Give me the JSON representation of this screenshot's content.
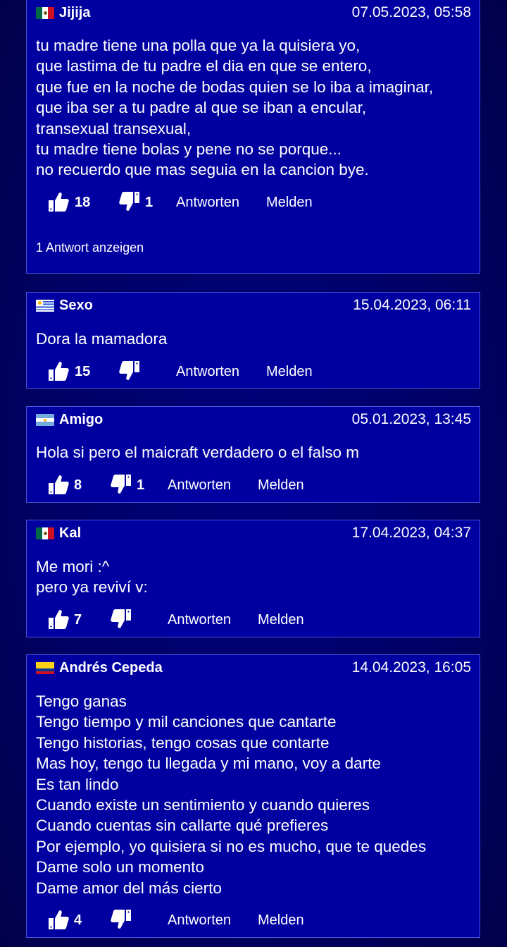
{
  "labels": {
    "reply": "Antworten",
    "report": "Melden"
  },
  "comments": [
    {
      "user": "Jijija",
      "flag": "mexico",
      "date": "07.05.2023, 05:58",
      "lines": [
        "tu madre tiene una polla que ya la quisiera yo,",
        "que lastima de tu padre el dia en que se entero,",
        "que fue en la noche de bodas quien se lo iba a imaginar,",
        "que iba ser a tu padre al que se iban a encular,",
        "transexual transexual,",
        "tu madre tiene bolas y pene no se porque...",
        "no recuerdo que mas seguia en la cancion bye."
      ],
      "likes": "18",
      "dislikes": "1",
      "show_replies": "1 Antwort anzeigen"
    },
    {
      "user": "Sexo",
      "flag": "uruguay",
      "date": "15.04.2023, 06:11",
      "lines": [
        "Dora la mamadora"
      ],
      "likes": "15",
      "dislikes": ""
    },
    {
      "user": "Amigo",
      "flag": "argentina",
      "date": "05.01.2023, 13:45",
      "lines": [
        "Hola si pero el maicraft verdadero o el falso m"
      ],
      "likes": "8",
      "dislikes": "1"
    },
    {
      "user": "Kal",
      "flag": "mexico",
      "date": "17.04.2023, 04:37",
      "lines": [
        "Me mori :^",
        "pero ya reviví v:"
      ],
      "likes": "7",
      "dislikes": ""
    },
    {
      "user": "Andrés Cepeda",
      "flag": "colombia",
      "date": "14.04.2023, 16:05",
      "lines": [
        "Tengo ganas",
        "Tengo tiempo y mil canciones que cantarte",
        "Tengo historias, tengo cosas que contarte",
        "Mas hoy, tengo tu llegada y mi mano, voy a darte",
        "Es tan lindo",
        "Cuando existe un sentimiento y cuando quieres",
        "Cuando cuentas sin callarte qué prefieres",
        "Por ejemplo, yo quisiera si no es mucho, que te quedes",
        "Dame solo un momento",
        "Dame amor del más cierto"
      ],
      "likes": "4",
      "dislikes": ""
    }
  ]
}
